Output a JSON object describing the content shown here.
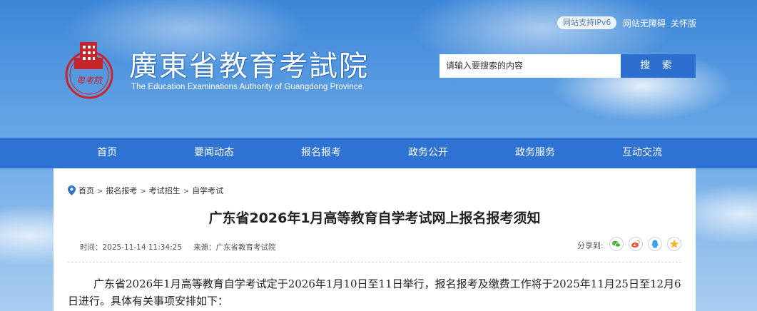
{
  "header": {
    "title_cn": "廣東省教育考試院",
    "title_en": "The Education Examinations Authority of Guangdong Province",
    "logo_text": "粤考院",
    "ipv6_badge": "网站支持IPv6",
    "accessibility_link": "网站无障碍",
    "care_link": "关怀版",
    "search_placeholder": "请输入要搜索的内容",
    "search_button": "搜 索"
  },
  "nav": {
    "items": [
      {
        "label": "首页"
      },
      {
        "label": "要闻动态"
      },
      {
        "label": "报名报考"
      },
      {
        "label": "政务公开"
      },
      {
        "label": "政务服务"
      },
      {
        "label": "互动交流"
      }
    ]
  },
  "breadcrumb": [
    "首页",
    "报名报考",
    "考试招生",
    "自学考试"
  ],
  "article": {
    "title": "广东省2026年1月高等教育自学考试网上报名报考须知",
    "time": "时间：2025-11-14 11:34:25",
    "source": "来源：广东省教育考试院",
    "share_label": "分享到:",
    "intro": "广东省2026年1月高等教育自学考试定于2026年1月10日至11日举行，报名报考及缴费工作将于2025年11月25日至12月6日进行。具体有关事项安排如下："
  },
  "share_icons": [
    {
      "name": "wechat-icon",
      "color": "#4db33d"
    },
    {
      "name": "weibo-icon",
      "color": "#e8553b"
    },
    {
      "name": "qq-icon",
      "color": "#3da0e8"
    },
    {
      "name": "qzone-icon",
      "color": "#f2b62c"
    }
  ],
  "colors": {
    "nav_bg": "#2e73d4",
    "search_button": "#2c6fd0",
    "logo_red": "#c8242c"
  }
}
